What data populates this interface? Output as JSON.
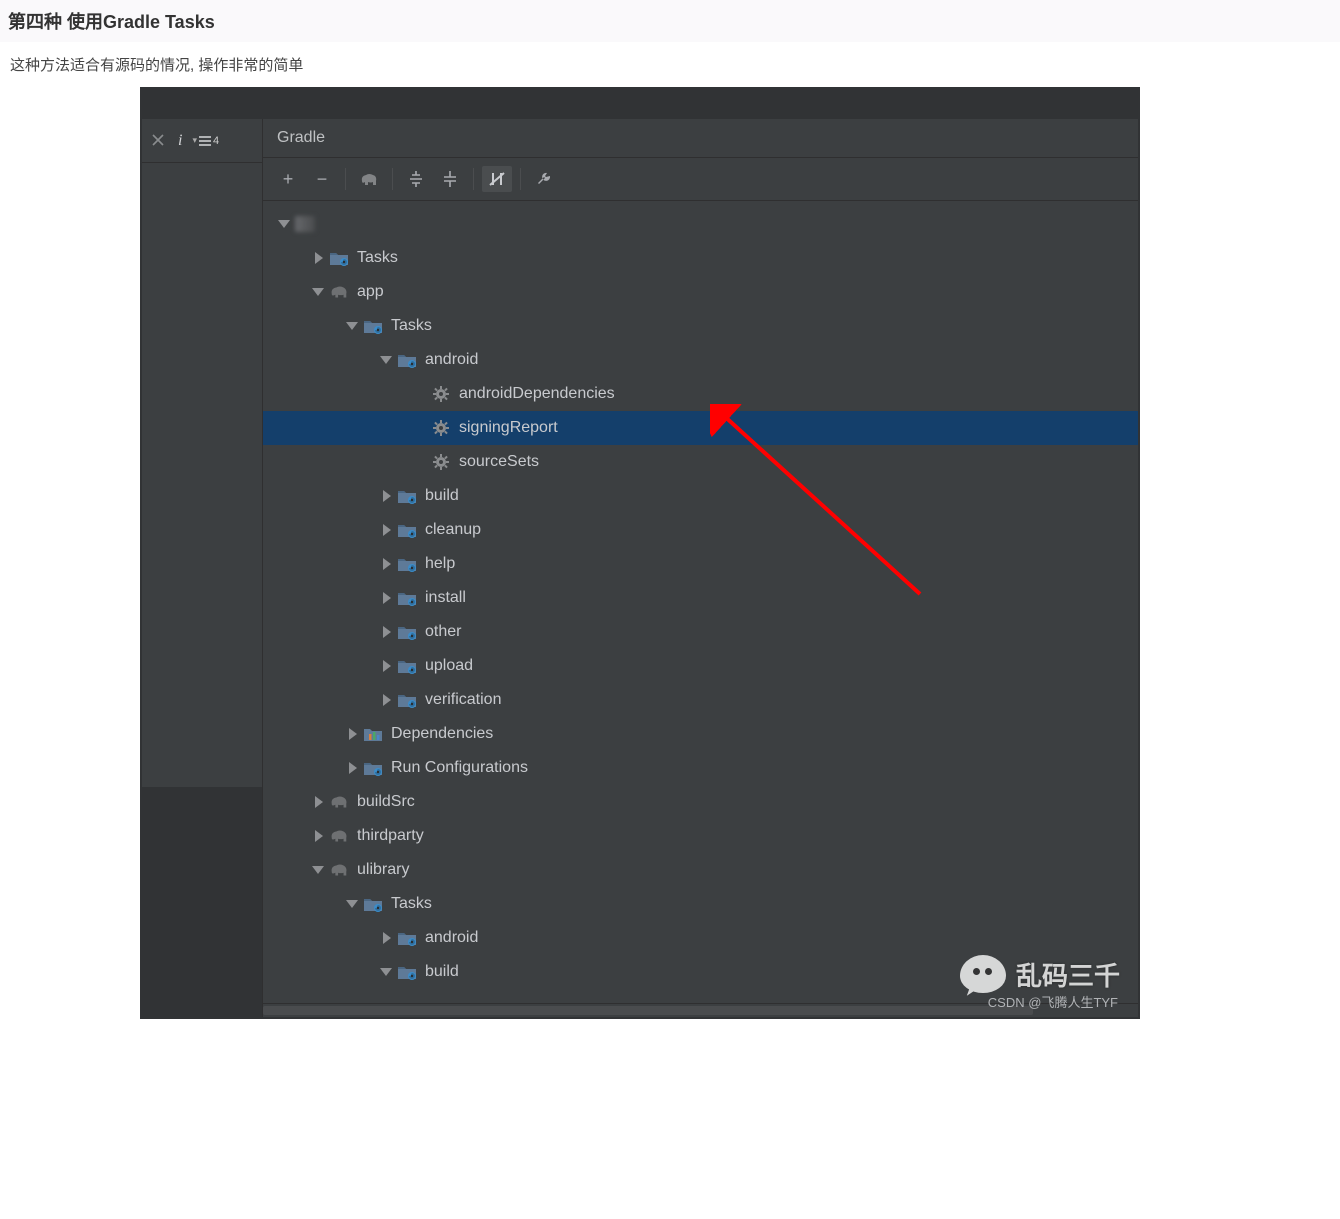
{
  "section": {
    "title": "第四种  使用Gradle Tasks",
    "desc": "这种方法适合有源码的情况, 操作非常的简单"
  },
  "leftRail": {
    "eqLabel": "4"
  },
  "panel": {
    "title": "Gradle"
  },
  "toolbar": {
    "plus": "+",
    "minus": "−"
  },
  "tree": [
    {
      "indent": 0,
      "arrow": "d",
      "icon": "blurred",
      "label": ""
    },
    {
      "indent": 1,
      "arrow": "r",
      "icon": "folder",
      "label": "Tasks"
    },
    {
      "indent": 1,
      "arrow": "d",
      "icon": "elephant",
      "label": "app"
    },
    {
      "indent": 2,
      "arrow": "d",
      "icon": "folder",
      "label": "Tasks"
    },
    {
      "indent": 3,
      "arrow": "d",
      "icon": "folder",
      "label": "android"
    },
    {
      "indent": 4,
      "arrow": "none",
      "icon": "gear",
      "label": "androidDependencies"
    },
    {
      "indent": 4,
      "arrow": "none",
      "icon": "gear",
      "label": "signingReport",
      "selected": true
    },
    {
      "indent": 4,
      "arrow": "none",
      "icon": "gear",
      "label": "sourceSets"
    },
    {
      "indent": 3,
      "arrow": "r",
      "icon": "folder",
      "label": "build"
    },
    {
      "indent": 3,
      "arrow": "r",
      "icon": "folder",
      "label": "cleanup"
    },
    {
      "indent": 3,
      "arrow": "r",
      "icon": "folder",
      "label": "help"
    },
    {
      "indent": 3,
      "arrow": "r",
      "icon": "folder",
      "label": "install"
    },
    {
      "indent": 3,
      "arrow": "r",
      "icon": "folder",
      "label": "other"
    },
    {
      "indent": 3,
      "arrow": "r",
      "icon": "folder",
      "label": "upload"
    },
    {
      "indent": 3,
      "arrow": "r",
      "icon": "folder",
      "label": "verification"
    },
    {
      "indent": 2,
      "arrow": "r",
      "icon": "deps",
      "label": "Dependencies"
    },
    {
      "indent": 2,
      "arrow": "r",
      "icon": "folder",
      "label": "Run Configurations"
    },
    {
      "indent": 1,
      "arrow": "r",
      "icon": "elephant",
      "label": "buildSrc"
    },
    {
      "indent": 1,
      "arrow": "r",
      "icon": "elephant",
      "label": "thirdparty"
    },
    {
      "indent": 1,
      "arrow": "d",
      "icon": "elephant",
      "label": "ulibrary"
    },
    {
      "indent": 2,
      "arrow": "d",
      "icon": "folder",
      "label": "Tasks"
    },
    {
      "indent": 3,
      "arrow": "r",
      "icon": "folder",
      "label": "android"
    },
    {
      "indent": 3,
      "arrow": "d",
      "icon": "folder",
      "label": "build"
    }
  ],
  "watermark": {
    "wechat": "乱码三千",
    "csdn": "CSDN @飞腾人生TYF"
  }
}
